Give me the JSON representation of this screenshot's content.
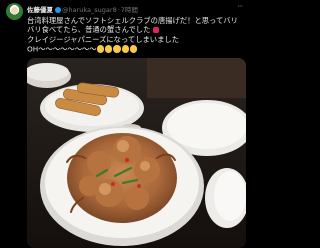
{
  "tweet": {
    "display_name": "佐藤優夏",
    "handle": "@haruka_sugar8",
    "separator": "·",
    "time": "7時間",
    "text_lines": [
      "台湾料理屋さんでソフトシェルクラブの唐揚げだ！と思ってバリ",
      "バリ食べてたら、普通の蟹さんでした",
      "クレイジージャパニーズになってしまいました",
      "OH〜〜〜〜〜〜〜〜"
    ],
    "icons": [
      "avatar",
      "verified-badge",
      "more-icon",
      "emoji"
    ]
  }
}
